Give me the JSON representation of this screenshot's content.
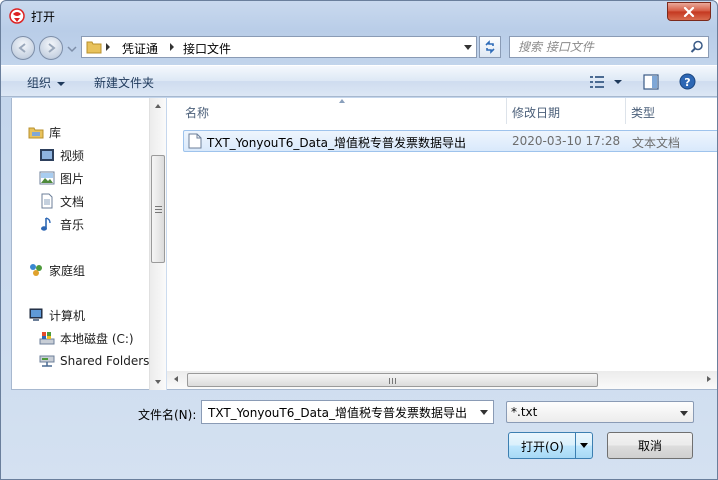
{
  "window": {
    "title": "打开",
    "close_icon": "close-icon"
  },
  "address_bar": {
    "crumbs": [
      "凭证通",
      "接口文件"
    ],
    "search_placeholder": "搜索 接口文件"
  },
  "toolbar": {
    "organize_label": "组织",
    "new_folder_label": "新建文件夹"
  },
  "nav_pane": {
    "items": [
      {
        "label": "库",
        "icon": "library-icon"
      },
      {
        "label": "视频",
        "icon": "video-icon"
      },
      {
        "label": "图片",
        "icon": "picture-icon"
      },
      {
        "label": "文档",
        "icon": "document-icon"
      },
      {
        "label": "音乐",
        "icon": "music-icon"
      },
      {
        "label": "家庭组",
        "icon": "homegroup-icon"
      },
      {
        "label": "计算机",
        "icon": "computer-icon"
      },
      {
        "label": "本地磁盘 (C:)",
        "icon": "drive-icon"
      },
      {
        "label": "Shared Folders",
        "icon": "network-drive-icon"
      }
    ]
  },
  "file_list": {
    "columns": {
      "name": "名称",
      "modified": "修改日期",
      "type": "类型"
    },
    "rows": [
      {
        "name": "TXT_YonyouT6_Data_增值税专普发票数据导出",
        "modified": "2020-03-10 17:28",
        "type": "文本文档"
      }
    ]
  },
  "footer": {
    "filename_label": "文件名(N):",
    "filename_value": "TXT_YonyouT6_Data_增值税专普发票数据导出",
    "filter_value": "*.txt",
    "open_label": "打开(O)",
    "cancel_label": "取消"
  },
  "colors": {
    "selection": "#d9e9fb",
    "selection_border": "#9ec3ec",
    "header_text": "#4c607a",
    "toolbar_text": "#1e395b"
  }
}
